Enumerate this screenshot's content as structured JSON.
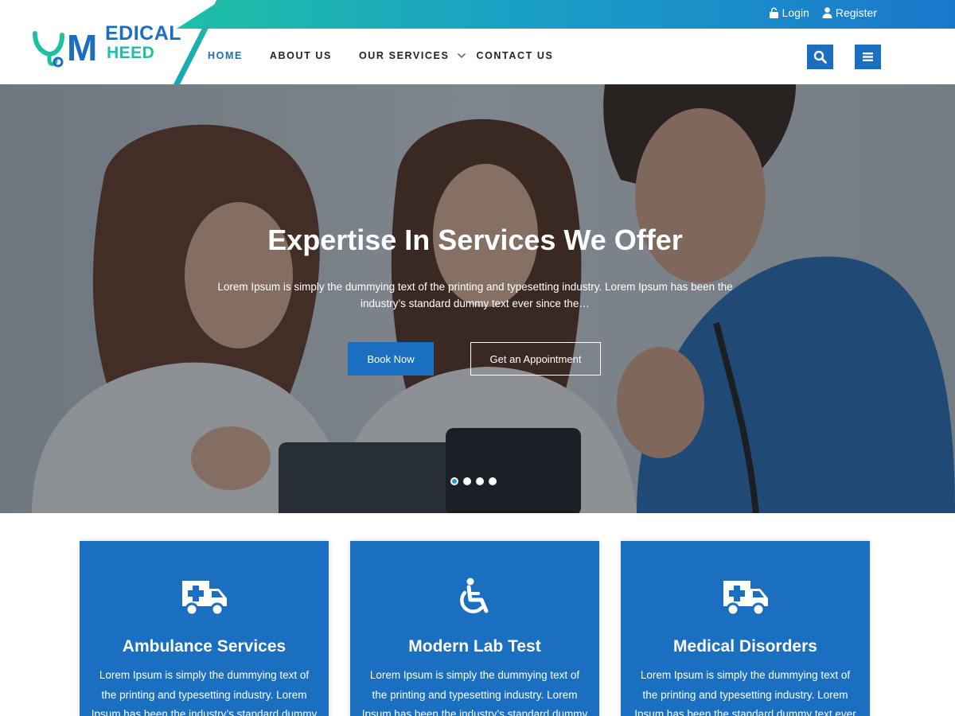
{
  "brand": {
    "logo_line1": "EDICAL",
    "logo_line2": "HEED",
    "logo_letters": "YM"
  },
  "topbar": {
    "login": {
      "label": "Login",
      "icon": "lock-icon"
    },
    "register": {
      "label": "Register",
      "icon": "user-icon"
    }
  },
  "nav": {
    "items": [
      {
        "label": "HOME",
        "active": true
      },
      {
        "label": "ABOUT US"
      },
      {
        "label": "OUR SERVICES",
        "has_dropdown": true
      },
      {
        "label": "CONTACT US"
      }
    ],
    "search_icon": "search-icon",
    "menu_icon": "hamburger-menu-icon"
  },
  "hero": {
    "title": "Expertise In Services We Offer",
    "description": "Lorem Ipsum is simply the dummying text of the printing and typesetting industry. Lorem Ipsum has been the industry’s standard dummy text ever since the…",
    "primary_button": "Book Now",
    "secondary_button": "Get an Appointment",
    "slides_total": 4,
    "slide_active": 1
  },
  "services": [
    {
      "icon": "ambulance-icon",
      "title": "Ambulance Services",
      "text": "Lorem Ipsum is simply the dummying text of the printing and typesetting industry. Lorem Ipsum has been the industry’s standard dummy text"
    },
    {
      "icon": "wheelchair-icon",
      "title": "Modern Lab Test",
      "text": "Lorem Ipsum is simply the dummying text of the printing and typesetting industry. Lorem Ipsum has been the industry’s standard dummy text"
    },
    {
      "icon": "ambulance-icon",
      "title": "Medical Disorders",
      "text": "Lorem Ipsum is simply the dummying text of the printing and typesetting industry. Lorem Ipsum has been the standard dummy text ever since"
    }
  ],
  "colors": {
    "primary": "#1a6fc0",
    "accent": "#1fbfa5",
    "white": "#ffffff"
  }
}
